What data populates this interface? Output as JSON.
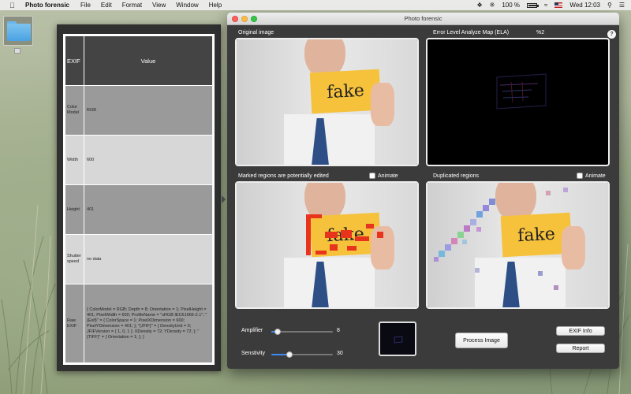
{
  "menubar": {
    "app_name": "Photo forensic",
    "items": [
      "File",
      "Edit",
      "Format",
      "View",
      "Window",
      "Help"
    ],
    "battery_text": "100 %",
    "battery_level": 1.0,
    "clock": "Wed 12:03"
  },
  "exif": {
    "header": {
      "key": "EXIF",
      "value": "Value"
    },
    "rows": [
      {
        "key": "Color Model",
        "value": "RGB"
      },
      {
        "key": "Width",
        "value": "600"
      },
      {
        "key": "Height",
        "value": "401"
      },
      {
        "key": "Shutter speed",
        "value": "no data"
      },
      {
        "key": "Raw EXIF",
        "value": "{ ColorModel = RGB; Depth = 8; Orientation = 1; PixelHeight = 401; PixelWidth = 600; ProfileName = \"sRGB IEC61966-2.1\"; \"{Exif}\" = { ColorSpace = 1; PixelXDimension = 600; PixelYDimension = 401; }; \"{JFIF}\" = { DensityUnit = 0; JFIFVersion = ( 1, 0, 1 ); XDensity = 72; YDensity = 72; }; \"{TIFF}\" = { Orientation = 1; }; }"
      }
    ]
  },
  "window": {
    "title": "Photo forensic",
    "original_label": "Original image",
    "ela_label": "Error Level Analyze Map (ELA)",
    "ela_percent": "%2",
    "help": "?",
    "marked_label": "Marked regions are potentially edited",
    "duplicated_label": "Duplicated regions",
    "animate_label": "Animate",
    "card_text": "fake"
  },
  "controls": {
    "amplifier_label": "Amplifier",
    "amplifier_value": "8",
    "amplifier_fraction": 0.1,
    "sensitivity_label": "Senstivity",
    "sensitivity_value": "30",
    "sensitivity_fraction": 0.3,
    "process_button": "Process Image",
    "exif_button": "EXIF Info",
    "report_button": "Report"
  },
  "colors": {
    "accent": "#3d8bf7",
    "card": "#f6c23c",
    "marked": "#e8341c"
  }
}
